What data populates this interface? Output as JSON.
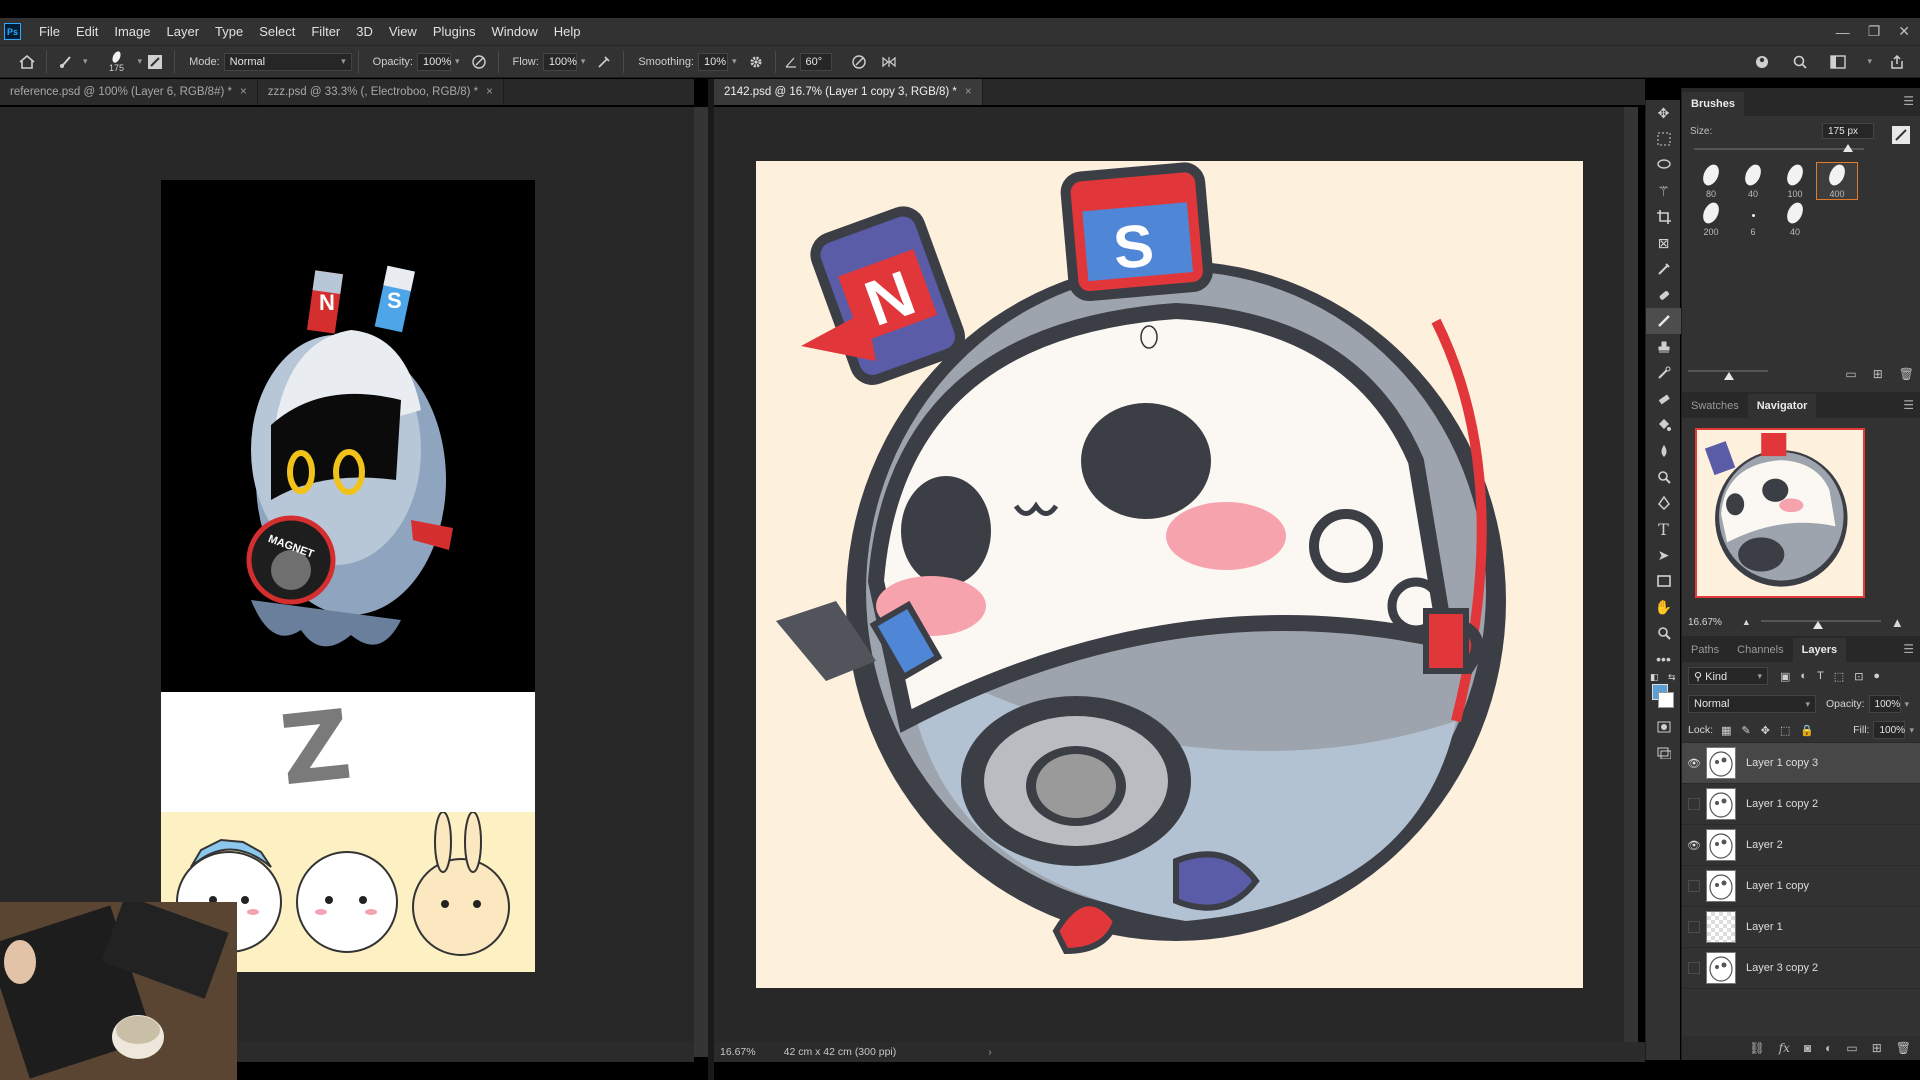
{
  "app": {
    "logo": "Ps"
  },
  "menubar": {
    "items": [
      "File",
      "Edit",
      "Image",
      "Layer",
      "Type",
      "Select",
      "Filter",
      "3D",
      "View",
      "Plugins",
      "Window",
      "Help"
    ]
  },
  "window_controls": {
    "minimize": "—",
    "restore": "❐",
    "close": "✕"
  },
  "options_bar": {
    "brush_size": "175",
    "mode_label": "Mode:",
    "mode_value": "Normal",
    "opacity_label": "Opacity:",
    "opacity_value": "100%",
    "flow_label": "Flow:",
    "flow_value": "100%",
    "smoothing_label": "Smoothing:",
    "smoothing_value": "10%",
    "angle_value": "60°"
  },
  "tabs_left": [
    {
      "label": "reference.psd @ 100% (Layer 6, RGB/8#) *"
    },
    {
      "label": "zzz.psd @ 33.3% (, Electroboo, RGB/8) *"
    }
  ],
  "tab_right": {
    "label": "2142.psd @ 16.7% (Layer 1 copy 3, RGB/8) *"
  },
  "tab_close": "×",
  "reference_art": {
    "magnet_n": "N",
    "magnet_s": "S",
    "badge_text": "MAGNET",
    "sketch_letter": "Z"
  },
  "canvas_art": {
    "magnet_n": "N",
    "magnet_s": "S"
  },
  "status": {
    "zoom": "16.67%",
    "doc_size": "42 cm x 42 cm (300 ppi)",
    "arrow": "›"
  },
  "brushes_panel": {
    "title": "Brushes",
    "size_label": "Size:",
    "size_value": "175 px",
    "size_fraction": 0.9,
    "presets": [
      {
        "size": "80",
        "active": false
      },
      {
        "size": "40",
        "active": false
      },
      {
        "size": "100",
        "active": false
      },
      {
        "size": "400",
        "active": true
      },
      {
        "size": "200",
        "active": false
      },
      {
        "size": "6",
        "active": false
      },
      {
        "size": "40",
        "active": false
      }
    ]
  },
  "navigator_panel": {
    "tabs": [
      "Swatches",
      "Navigator"
    ],
    "active_tab": "Navigator",
    "zoom": "16.67%"
  },
  "layers_panel": {
    "tabs": [
      "Paths",
      "Channels",
      "Layers"
    ],
    "active_tab": "Layers",
    "filter_label": "Kind",
    "blend_mode": "Normal",
    "opacity_label": "Opacity:",
    "opacity_value": "100%",
    "lock_label": "Lock:",
    "fill_label": "Fill:",
    "fill_value": "100%",
    "layers": [
      {
        "name": "Layer 1 copy 3",
        "visible": true,
        "active": true
      },
      {
        "name": "Layer 1 copy 2",
        "visible": false,
        "active": false
      },
      {
        "name": "Layer 2",
        "visible": true,
        "active": false
      },
      {
        "name": "Layer 1 copy",
        "visible": false,
        "active": false
      },
      {
        "name": "Layer 1",
        "visible": false,
        "active": false
      },
      {
        "name": "Layer 3 copy 2",
        "visible": false,
        "active": false
      }
    ]
  },
  "colors": {
    "foreground": "#5b9fd6",
    "background": "#ffffff",
    "accent_orange": "#e07b2c",
    "canvas_bg": "#fdf0dc"
  }
}
